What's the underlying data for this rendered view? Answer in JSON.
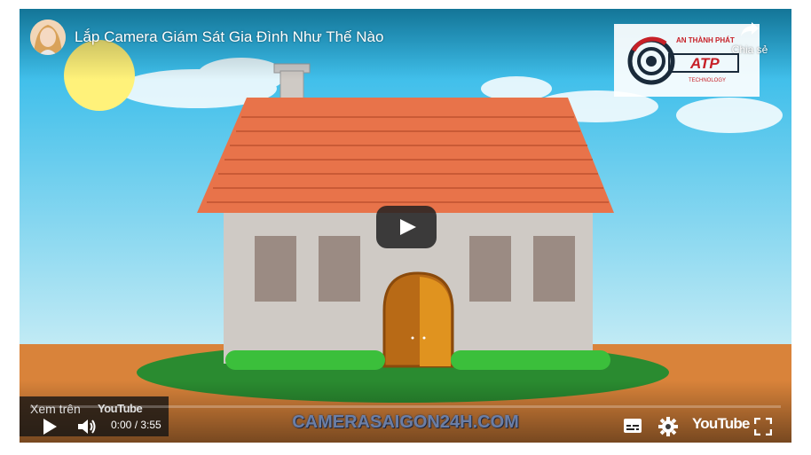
{
  "video": {
    "title": "Lắp Camera Giám Sát Gia Đình Như Thế Nào",
    "watermark": "CAMERASAIGON24H.COM"
  },
  "channel_logo": {
    "brand_text": "AN THÀNH PHÁT",
    "mark": "ATP",
    "sub": "TECHNOLOGY"
  },
  "share": {
    "label": "Chia sẻ"
  },
  "watch_on": {
    "label": "Xem trên",
    "brand": "YouTube"
  },
  "controls": {
    "time": "0:00 / 3:55",
    "youtube_label": "YouTube",
    "progress": 0
  },
  "colors": {
    "sky": "#8fd3ee",
    "roof": "#e8734a",
    "wall": "#cfcac5",
    "ground": "#e08a3a",
    "lawn": "#2e8b2e",
    "door": "#c8781a"
  }
}
